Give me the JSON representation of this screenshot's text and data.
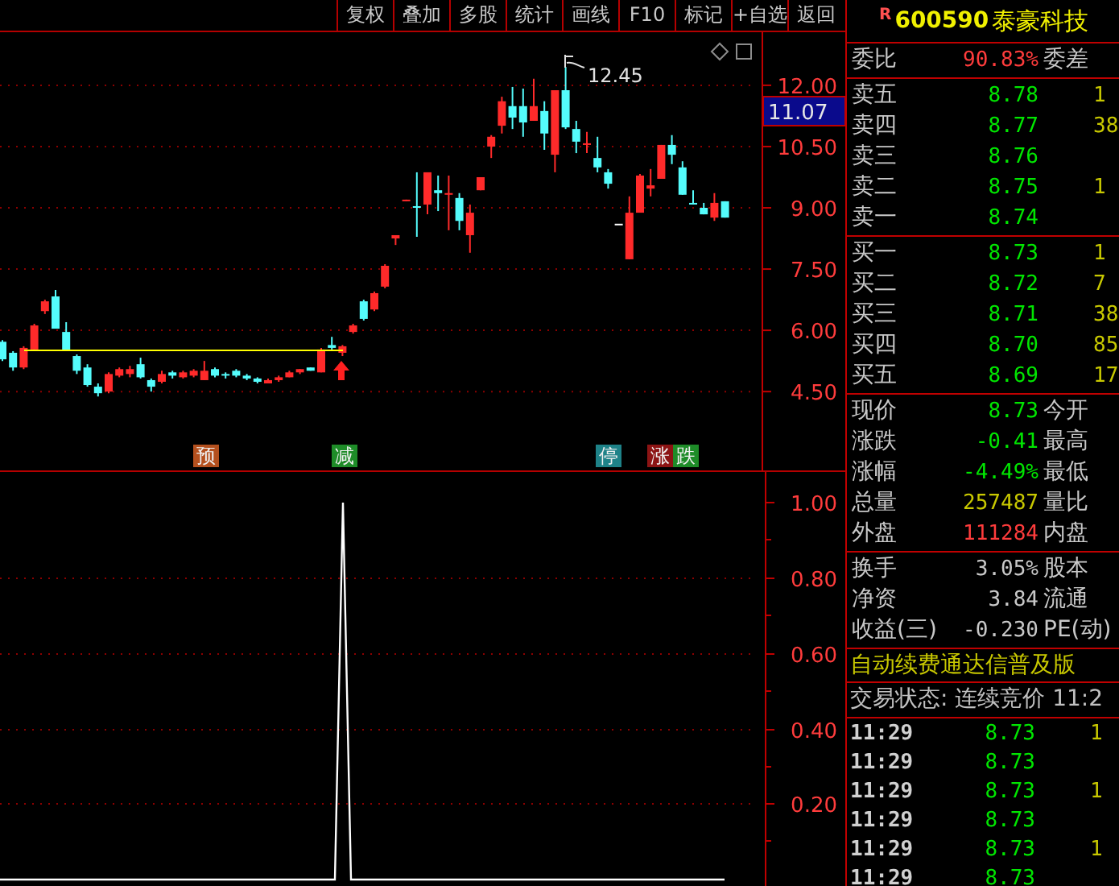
{
  "toolbar": {
    "buttons": [
      "复权",
      "叠加",
      "多股",
      "统计",
      "画线",
      "F10",
      "标记",
      "+自选",
      "返回"
    ]
  },
  "stock": {
    "badge": "R",
    "code": "600590",
    "name": "泰豪科技"
  },
  "price_chart": {
    "current_price": "11.07",
    "peak_label": "12.45",
    "chart_data": {
      "type": "candlestick",
      "ylim": [
        2.57,
        13.3
      ],
      "grid": true,
      "yticks": [
        {
          "value": 12,
          "label": "12.00"
        },
        {
          "value": 10.5,
          "label": "10.50"
        },
        {
          "value": 9,
          "label": "9.00"
        },
        {
          "value": 7.5,
          "label": "7.50"
        },
        {
          "value": 6,
          "label": "6.00"
        },
        {
          "value": 4.5,
          "label": "4.50"
        }
      ],
      "ohlc": [
        [
          5.72,
          5.76,
          5.25,
          5.29
        ],
        [
          5.45,
          5.49,
          5.01,
          5.09
        ],
        [
          5.09,
          5.61,
          5.05,
          5.57
        ],
        [
          5.53,
          6.16,
          5.49,
          6.12
        ],
        [
          6.47,
          6.75,
          6.4,
          6.71
        ],
        [
          6.83,
          6.99,
          6.04,
          6.04
        ],
        [
          5.96,
          6.2,
          5.49,
          5.49
        ],
        [
          5.37,
          5.41,
          4.93,
          5.01
        ],
        [
          5.09,
          5.17,
          4.62,
          4.66
        ],
        [
          4.62,
          4.7,
          4.38,
          4.46
        ],
        [
          4.5,
          4.97,
          4.46,
          4.93
        ],
        [
          4.89,
          5.09,
          4.85,
          5.05
        ],
        [
          4.93,
          5.13,
          4.85,
          5.05
        ],
        [
          5.17,
          5.33,
          4.82,
          4.85
        ],
        [
          4.78,
          4.82,
          4.5,
          4.62
        ],
        [
          4.74,
          5.01,
          4.7,
          4.93
        ],
        [
          4.97,
          5.01,
          4.82,
          4.89
        ],
        [
          4.85,
          5.01,
          4.82,
          4.97
        ],
        [
          4.89,
          5.05,
          4.85,
          5.01
        ],
        [
          4.78,
          5.25,
          4.78,
          5.01
        ],
        [
          5.05,
          5.09,
          4.85,
          4.89
        ],
        [
          4.93,
          4.97,
          4.82,
          4.89
        ],
        [
          5.01,
          5.05,
          4.85,
          4.89
        ],
        [
          4.89,
          4.93,
          4.78,
          4.82
        ],
        [
          4.82,
          4.85,
          4.7,
          4.74
        ],
        [
          4.7,
          4.82,
          4.7,
          4.78
        ],
        [
          4.78,
          4.89,
          4.74,
          4.85
        ],
        [
          4.85,
          5.01,
          4.85,
          4.97
        ],
        [
          4.97,
          5.05,
          4.93,
          5.05
        ],
        [
          5.09,
          5.09,
          5.01,
          5.01
        ],
        [
          4.97,
          5.57,
          4.97,
          5.53
        ],
        [
          5.64,
          5.84,
          5.53,
          5.57
        ],
        [
          5.45,
          5.64,
          5.37,
          5.61
        ],
        [
          5.96,
          6.16,
          5.92,
          6.12
        ],
        [
          6.71,
          6.75,
          6.24,
          6.28
        ],
        [
          6.51,
          6.95,
          6.47,
          6.91
        ],
        [
          7.07,
          7.62,
          7.03,
          7.58
        ],
        [
          8.25,
          8.33,
          8.09,
          8.33
        ],
        [
          9.16,
          9.2,
          9.16,
          9.2
        ],
        [
          9.04,
          9.87,
          8.29,
          9.0
        ],
        [
          9.08,
          9.87,
          8.84,
          9.87
        ],
        [
          9.43,
          9.79,
          8.92,
          9.36
        ],
        [
          9.32,
          9.79,
          8.45,
          9.36
        ],
        [
          9.24,
          9.36,
          8.45,
          8.68
        ],
        [
          8.33,
          9.08,
          7.9,
          8.88
        ],
        [
          9.43,
          9.75,
          9.43,
          9.75
        ],
        [
          10.5,
          10.78,
          10.22,
          10.74
        ],
        [
          11.01,
          11.72,
          10.82,
          11.61
        ],
        [
          11.49,
          11.96,
          10.93,
          11.21
        ],
        [
          11.49,
          11.92,
          10.74,
          11.09
        ],
        [
          11.13,
          12.16,
          11.13,
          11.49
        ],
        [
          11.37,
          11.61,
          10.42,
          10.82
        ],
        [
          10.3,
          11.88,
          9.87,
          11.88
        ],
        [
          11.88,
          12.45,
          10.93,
          10.97
        ],
        [
          10.93,
          11.13,
          10.34,
          10.62
        ],
        [
          10.54,
          10.86,
          10.34,
          10.58
        ],
        [
          10.22,
          10.74,
          9.87,
          9.99
        ],
        [
          9.87,
          9.95,
          9.47,
          9.59
        ],
        [
          8.61,
          8.61,
          8.61,
          8.61
        ],
        [
          7.74,
          9.28,
          7.74,
          8.88
        ],
        [
          8.88,
          9.83,
          8.88,
          9.79
        ],
        [
          9.47,
          9.95,
          9.28,
          9.55
        ],
        [
          9.71,
          10.54,
          9.71,
          10.54
        ],
        [
          10.54,
          10.78,
          10.07,
          10.3
        ],
        [
          9.99,
          10.14,
          9.32,
          9.32
        ],
        [
          9.12,
          9.43,
          9.08,
          9.08
        ],
        [
          9.0,
          9.12,
          8.84,
          8.84
        ],
        [
          8.76,
          9.36,
          8.68,
          9.12
        ],
        [
          9.16,
          9.16,
          8.76,
          8.76
        ]
      ]
    },
    "signals": [
      {
        "label": "预",
        "color": "#b4501e"
      },
      {
        "label": "减",
        "color": "#1e8c28"
      },
      {
        "label": "停",
        "color": "#1e8288"
      },
      {
        "label": "涨",
        "color": "#8c1414"
      },
      {
        "label": "跌",
        "color": "#1e8c28"
      }
    ]
  },
  "indicator_chart": {
    "axis_labels": [
      "1.00",
      "0.80",
      "0.60",
      "0.40",
      "0.20"
    ]
  },
  "quote": {
    "order_ratio": {
      "label": "委比",
      "value": "90.83%",
      "color": "#ff3c3c",
      "label_2": "委差"
    },
    "asks": [
      {
        "label": "卖五",
        "price": "8.78",
        "volume": "1"
      },
      {
        "label": "卖四",
        "price": "8.77",
        "volume": "38"
      },
      {
        "label": "卖三",
        "price": "8.76"
      },
      {
        "label": "卖二",
        "price": "8.75",
        "volume": "1"
      },
      {
        "label": "卖一",
        "price": "8.74"
      }
    ],
    "bids": [
      {
        "label": "买一",
        "price": "8.73",
        "volume": "1"
      },
      {
        "label": "买二",
        "price": "8.72",
        "volume": "7"
      },
      {
        "label": "买三",
        "price": "8.71",
        "volume": "38"
      },
      {
        "label": "买四",
        "price": "8.70",
        "volume": "85"
      },
      {
        "label": "买五",
        "price": "8.69",
        "volume": "17"
      }
    ],
    "stats": [
      {
        "label": "现价",
        "value": "8.73",
        "color": "#00e600",
        "label_2": "今开"
      },
      {
        "label": "涨跌",
        "value": "-0.41",
        "color": "#00e600",
        "label_2": "最高"
      },
      {
        "label": "涨幅",
        "value": "-4.49%",
        "color": "#00e600",
        "label_2": "最低"
      },
      {
        "label": "总量",
        "value": "257487",
        "color": "#c8c800",
        "label_2": "量比"
      },
      {
        "label": "外盘",
        "value": "111284",
        "color": "#ff3c3c",
        "label_2": "内盘"
      }
    ],
    "fundamentals": [
      {
        "label": "换手",
        "value": "3.05%",
        "label_2": "股本"
      },
      {
        "label": "净资",
        "value": "3.84",
        "label_2": "流通"
      },
      {
        "label": "收益(三)",
        "value": "-0.230",
        "label_2": "PE(动)"
      }
    ],
    "banner": "自动续费通达信普及版",
    "status": "交易状态: 连续竞价 11:2",
    "ticks": [
      {
        "time": "11:29",
        "price": "8.73",
        "volume": "1"
      },
      {
        "time": "11:29",
        "price": "8.73"
      },
      {
        "time": "11:29",
        "price": "8.73",
        "volume": "1"
      },
      {
        "time": "11:29",
        "price": "8.73"
      },
      {
        "time": "11:29",
        "price": "8.73",
        "volume": "1"
      },
      {
        "time": "11:29",
        "price": "8.73"
      }
    ]
  }
}
